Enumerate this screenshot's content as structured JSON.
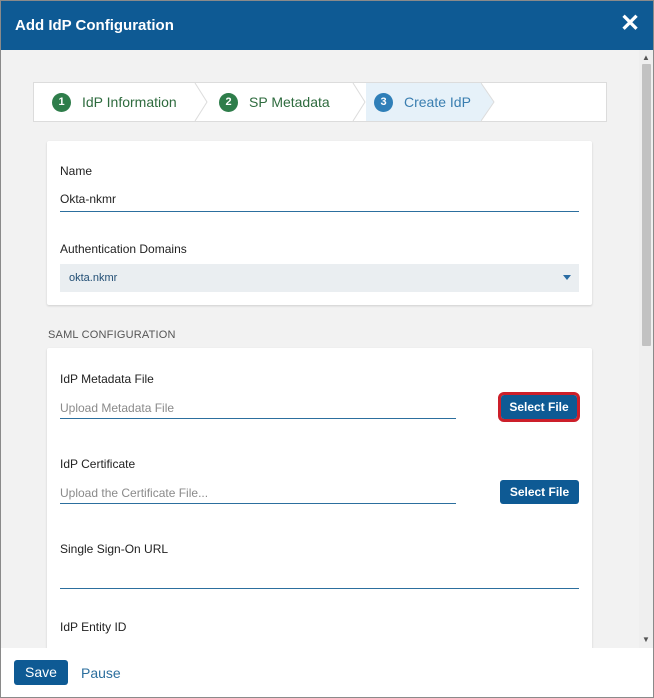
{
  "dialog": {
    "title": "Add IdP Configuration",
    "close_glyph": "✕"
  },
  "steps": [
    {
      "number": "1",
      "label": "IdP Information",
      "state": "done"
    },
    {
      "number": "2",
      "label": "SP Metadata",
      "state": "done"
    },
    {
      "number": "3",
      "label": "Create IdP",
      "state": "active"
    }
  ],
  "form": {
    "name_label": "Name",
    "name_value": "Okta-nkmr",
    "auth_domains_label": "Authentication Domains",
    "auth_domains_value": "okta.nkmr"
  },
  "saml": {
    "section_title": "SAML CONFIGURATION",
    "metadata_label": "IdP Metadata File",
    "metadata_placeholder": "Upload Metadata File",
    "metadata_button": "Select File",
    "cert_label": "IdP Certificate",
    "cert_placeholder": "Upload the Certificate File...",
    "cert_button": "Select File",
    "sso_label": "Single Sign-On URL",
    "sso_value": "",
    "entity_label": "IdP Entity ID"
  },
  "footer": {
    "save_label": "Save",
    "pause_label": "Pause"
  },
  "colors": {
    "header": "#0e5a94",
    "done_step": "#2e7d4a",
    "active_step": "#2f7fb8",
    "highlight": "#cc1f2a"
  }
}
